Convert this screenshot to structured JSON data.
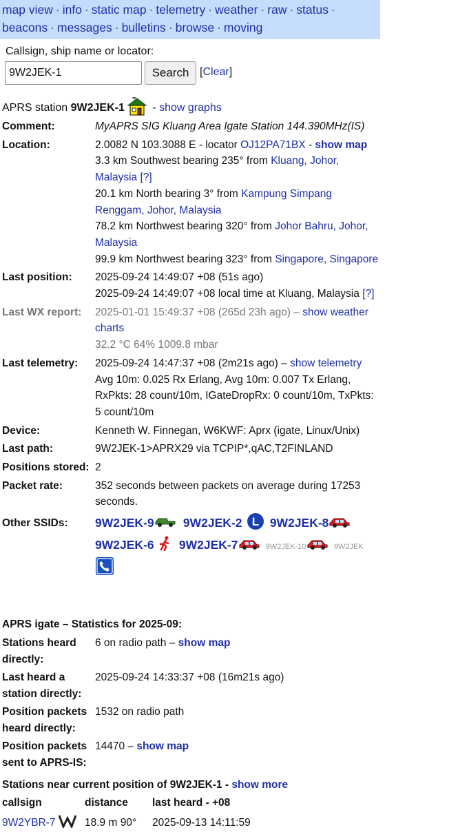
{
  "nav": {
    "items": [
      "map view",
      "info",
      "static map",
      "telemetry",
      "weather",
      "raw",
      "status",
      "beacons",
      "messages",
      "bulletins",
      "browse",
      "moving"
    ],
    "separator": "·"
  },
  "search": {
    "label": "Callsign, ship name or locator:",
    "value": "9W2JEK-1",
    "button": "Search",
    "clear": "Clear"
  },
  "station": {
    "prefix": "APRS station",
    "callsign": "9W2JEK-1",
    "dash": "-",
    "graphs_link": "show graphs",
    "symbol_icon": "house-icon"
  },
  "info": {
    "comment_label": "Comment:",
    "comment": "MyAPRS SIG Kluang Area Igate Station 144.390MHz(IS)",
    "location_label": "Location:",
    "coords": "2.0082 N 103.3088 E - locator",
    "locator": "OJ12PA71BX",
    "show_map_dash": "-",
    "show_map": "show map",
    "near1_text": "3.3 km Southwest bearing 235° from",
    "near1_place": "Kluang, Johor, Malaysia",
    "near1_help": "[?]",
    "near2_text": "20.1 km North bearing 3° from",
    "near2_place": "Kampung Simpang Renggam, Johor, Malaysia",
    "near3_text": "78.2 km Northwest bearing 320° from",
    "near3_place": "Johor Bahru, Johor, Malaysia",
    "near4_text": "99.9 km Northwest bearing 323° from",
    "near4_place": "Singapore, Singapore",
    "last_pos_label": "Last position:",
    "last_pos_1": "2025-09-24 14:49:07 +08 (51s ago)",
    "last_pos_2": "2025-09-24 14:49:07 +08 local time at Kluang, Malaysia",
    "last_pos_help": "[?]",
    "wx_label": "Last WX report:",
    "wx_time": "2025-01-01 15:49:37 +08 (265d 23h ago) –",
    "wx_link": "show weather charts",
    "wx_values": "32.2 °C 64% 1009.8 mbar",
    "telem_label": "Last telemetry:",
    "telem_time": "2025-09-24 14:47:37 +08 (2m21s ago) –",
    "telem_link": "show telemetry",
    "telem_values": "Avg 10m: 0.025 Rx Erlang, Avg 10m: 0.007 Tx Erlang, RxPkts: 28 count/10m, IGateDropRx: 0 count/10m, TxPkts: 5 count/10m",
    "device_label": "Device:",
    "device": "Kenneth W. Finnegan, W6KWF: Aprx (igate, Linux/Unix)",
    "path_label": "Last path:",
    "path": "9W2JEK-1>APRX29 via TCPIP*,qAC,T2FINLAND",
    "positions_label": "Positions stored:",
    "positions": "2",
    "rate_label": "Packet rate:",
    "rate": "352 seconds between packets on average during 17253 seconds.",
    "ssids_label": "Other SSIDs:",
    "ssids": [
      {
        "call": "9W2JEK-9",
        "icon": "jeep-icon"
      },
      {
        "call": "9W2JEK-2",
        "icon": "l-circle-icon"
      },
      {
        "call": "9W2JEK-8",
        "icon": "car-icon"
      },
      {
        "call": "9W2JEK-6",
        "icon": "running-person-icon"
      },
      {
        "call": "9W2JEK-7",
        "icon": "car-icon"
      }
    ],
    "ssids_small": [
      {
        "call": "9W2JEK-10",
        "icon": "car-icon"
      },
      {
        "call": "9W2JEK",
        "icon": "phone-icon"
      }
    ]
  },
  "igate": {
    "title": "APRS igate – Statistics for 2025-09:",
    "heard_label": "Stations heard directly:",
    "heard": "6 on radio path –",
    "heard_link": "show map",
    "last_heard_label": "Last heard a station directly:",
    "last_heard": "2025-09-24 14:33:37 +08 (16m21s ago)",
    "pos_heard_label": "Position packets heard directly:",
    "pos_heard": "1532 on radio path",
    "pos_sent_label": "Position packets sent to APRS-IS:",
    "pos_sent": "14470 –",
    "pos_sent_link": "show map"
  },
  "near": {
    "title_prefix": "Stations near current position of",
    "callsign": "9W2JEK-1",
    "dash": "-",
    "more_link": "show more",
    "headers": [
      "callsign",
      "distance",
      "last heard - +08"
    ],
    "rows": [
      {
        "callsign": "9W2YBR-7",
        "icon": "digi-star-icon",
        "distance": "18.9 m 90°",
        "last_heard": "2025-09-13 14:11:59"
      }
    ]
  },
  "colors": {
    "nav_bg": "#c5dcfc",
    "link": "#1f2fa8",
    "grey": "#777777"
  }
}
